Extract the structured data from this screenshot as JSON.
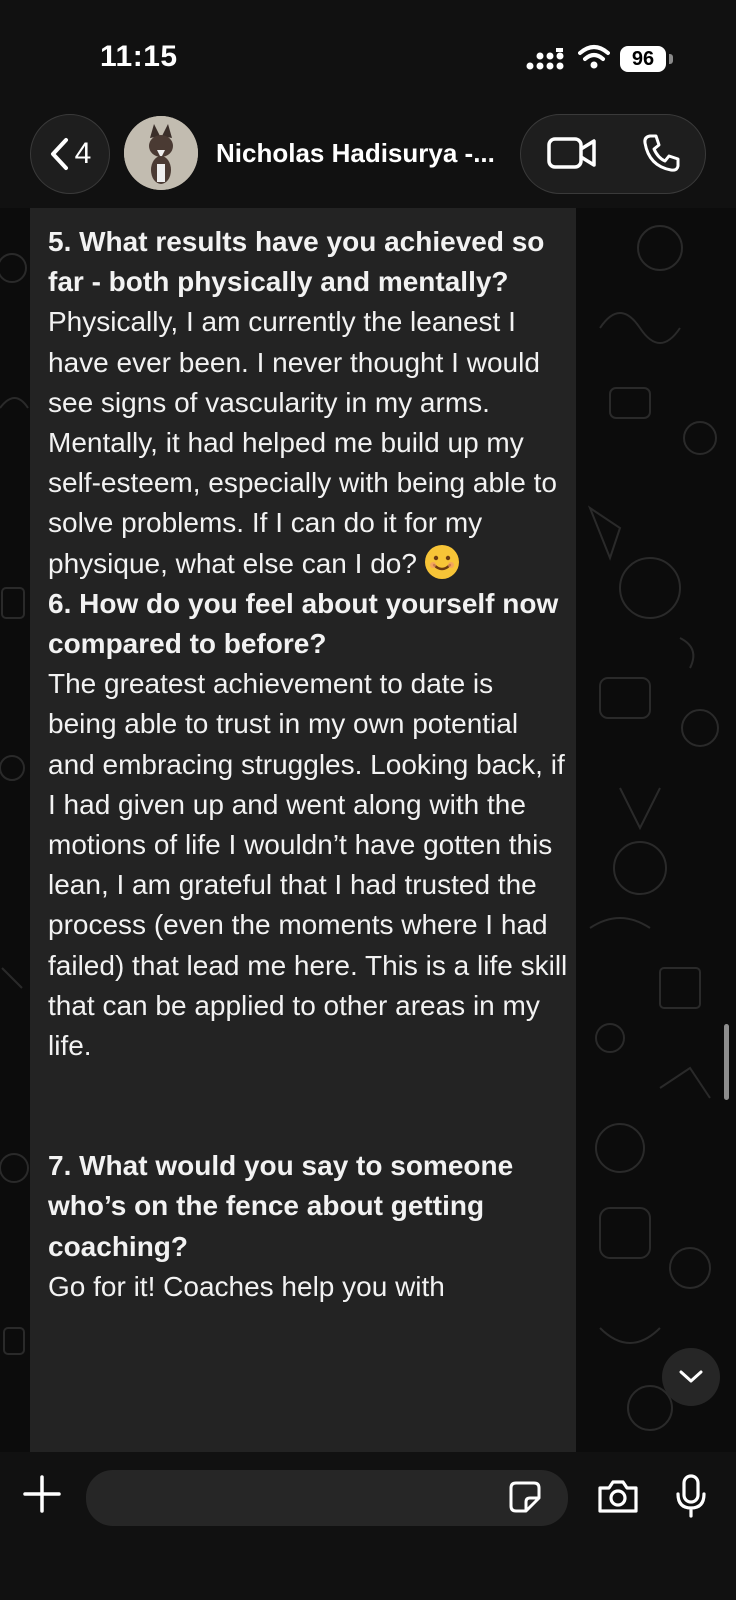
{
  "status_bar": {
    "time": "11:15",
    "battery": "96"
  },
  "header": {
    "back_count": "4",
    "contact_name": "Nicholas Hadisurya -..."
  },
  "message": {
    "q5": "5. What results have you achieved so far - both physically and mentally?",
    "a5_1": "Physically, I am currently the leanest I have ever been. I never thought I would see signs of vascularity in my arms.",
    "a5_2": "Mentally, it had helped me build up my self-esteem, especially with being able to solve problems. If I can do it for my physique, what else can I do?",
    "q6": "6. How do you feel about yourself now compared to before?",
    "a6": "The greatest achievement to date is being able to trust in my own potential and embracing struggles. Looking back, if I had given up and went along with the motions of life I wouldn’t have gotten this lean, I am grateful that I had trusted the process (even the moments where I had failed) that lead me here. This is a life skill that can be applied to other areas in my life.",
    "q7": "7. What would you say to someone who’s on the fence about getting coaching?",
    "a7_partial": "Go for it! Coaches help you with"
  },
  "icons": {
    "back": "chevron-left-icon",
    "video": "video-camera-icon",
    "phone": "phone-icon",
    "plus": "plus-icon",
    "sticker": "sticker-icon",
    "camera": "camera-icon",
    "mic": "microphone-icon",
    "scroll_down": "chevron-down-icon"
  },
  "colors": {
    "bubble": "#232323",
    "background": "#0c0c0c",
    "bar": "#111111"
  }
}
